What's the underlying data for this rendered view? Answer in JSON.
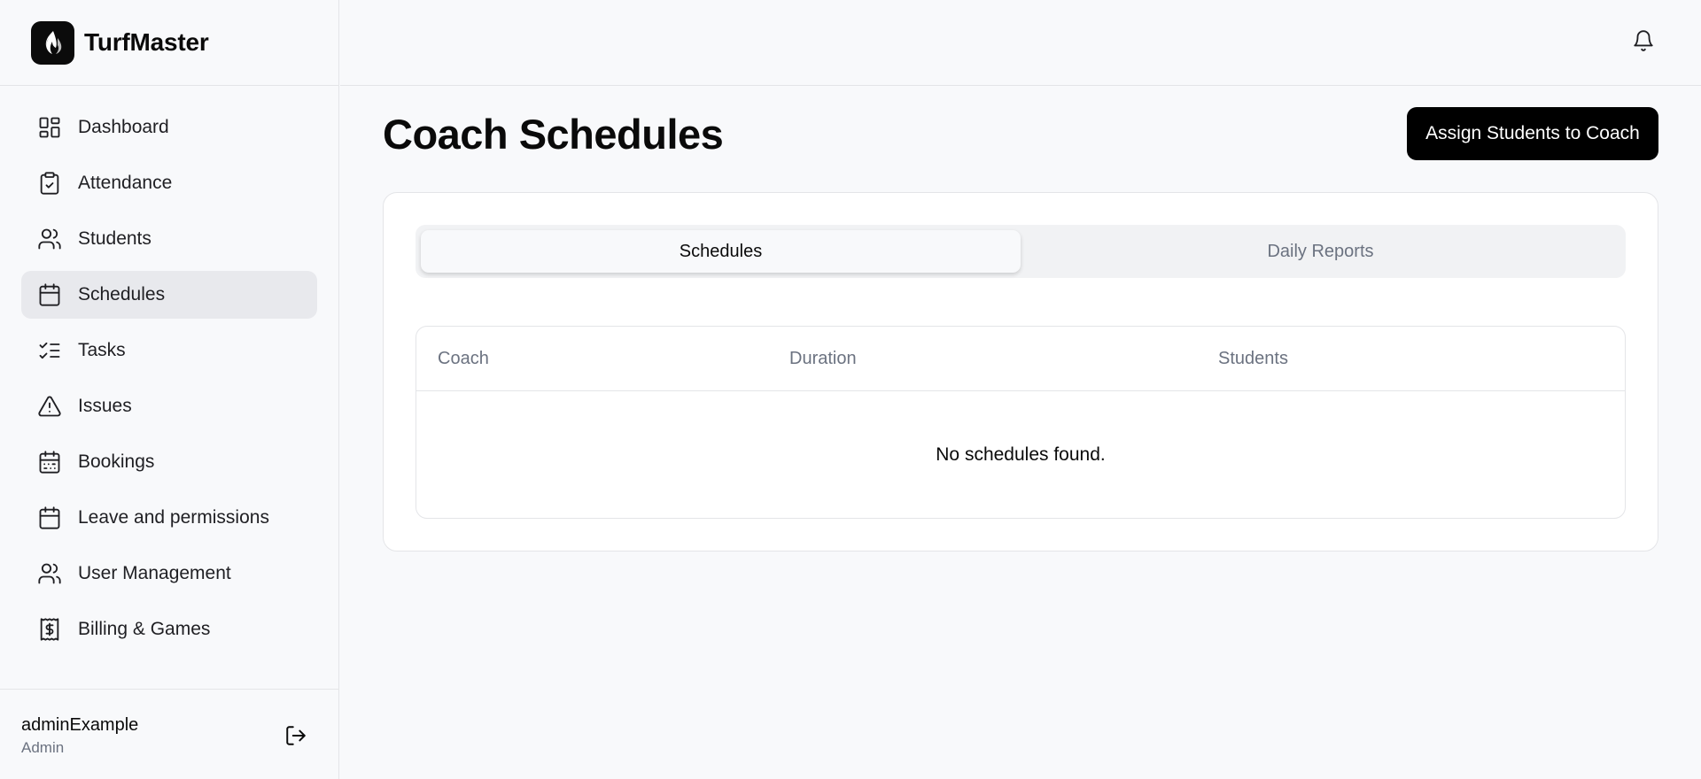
{
  "app": {
    "name": "TurfMaster",
    "logo_icon": "flame-logo-icon"
  },
  "sidebar": {
    "items": [
      {
        "label": "Dashboard",
        "icon": "layout-grid-icon",
        "active": false
      },
      {
        "label": "Attendance",
        "icon": "clipboard-check-icon",
        "active": false
      },
      {
        "label": "Students",
        "icon": "users-icon",
        "active": false
      },
      {
        "label": "Schedules",
        "icon": "calendar-icon",
        "active": true
      },
      {
        "label": "Tasks",
        "icon": "list-checks-icon",
        "active": false
      },
      {
        "label": "Issues",
        "icon": "alert-triangle-icon",
        "active": false
      },
      {
        "label": "Bookings",
        "icon": "calendar-range-icon",
        "active": false
      },
      {
        "label": "Leave and permissions",
        "icon": "calendar-icon",
        "active": false
      },
      {
        "label": "User Management",
        "icon": "users-icon",
        "active": false
      },
      {
        "label": "Billing & Games",
        "icon": "receipt-icon",
        "active": false
      }
    ]
  },
  "user": {
    "name": "adminExample",
    "role": "Admin"
  },
  "header": {
    "notifications_icon": "bell-icon"
  },
  "main": {
    "title": "Coach Schedules",
    "primary_action": "Assign Students to Coach",
    "tabs": [
      {
        "label": "Schedules",
        "active": true
      },
      {
        "label": "Daily Reports",
        "active": false
      }
    ],
    "table": {
      "columns": [
        "Coach",
        "Duration",
        "Students"
      ],
      "empty_message": "No schedules found."
    }
  },
  "colors": {
    "background": "#f8f9fb",
    "active_nav": "#e8e9ed",
    "primary": "#000000",
    "muted_text": "#6b7280",
    "border": "#e4e5e8"
  }
}
